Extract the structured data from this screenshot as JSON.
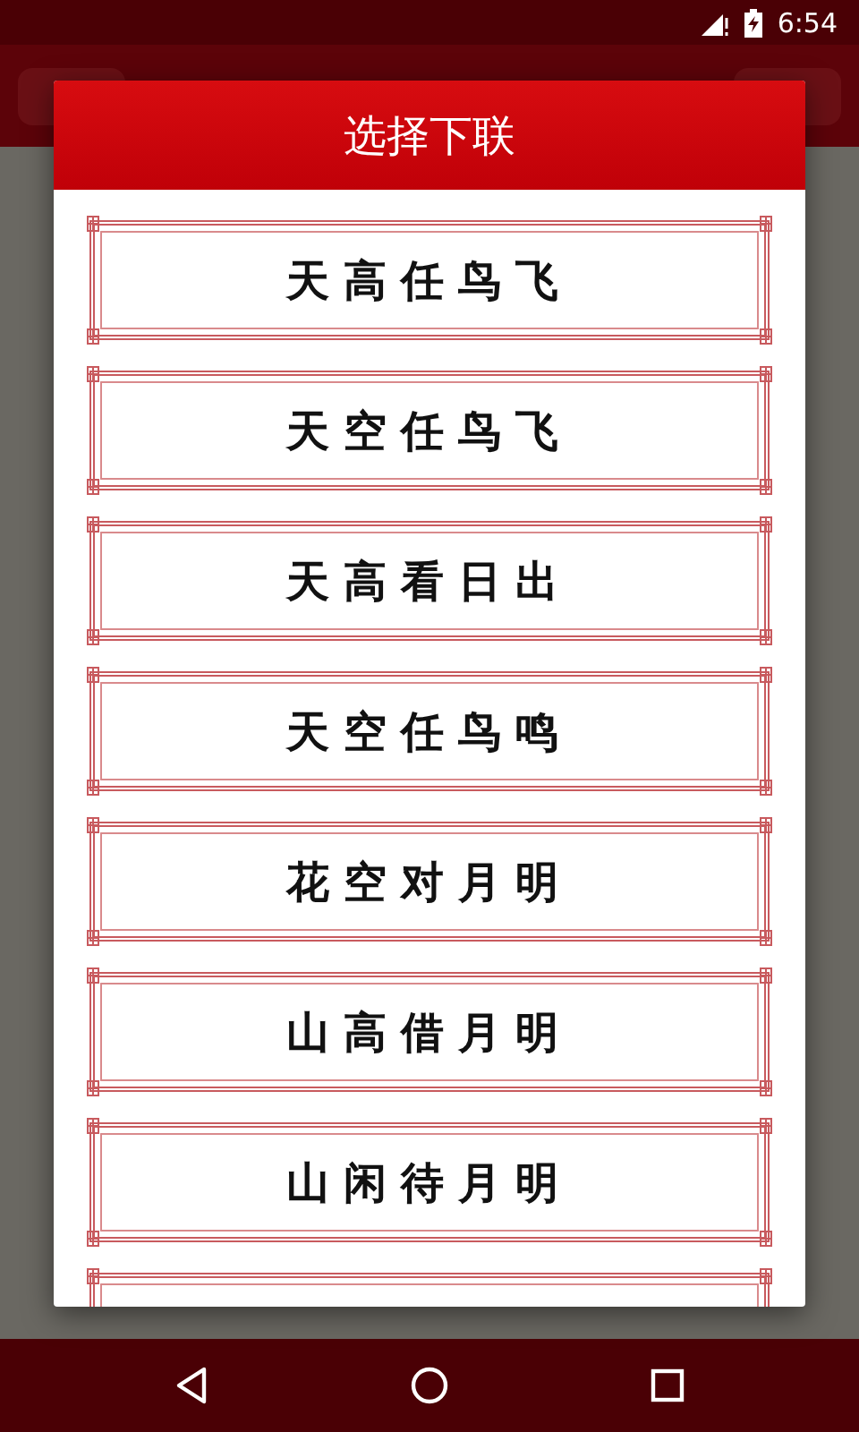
{
  "status_bar": {
    "time": "6:54"
  },
  "dialog": {
    "title": "选择下联",
    "options": [
      {
        "text": "天高任鸟飞"
      },
      {
        "text": "天空任鸟飞"
      },
      {
        "text": "天高看日出"
      },
      {
        "text": "天空任鸟鸣"
      },
      {
        "text": "花空对月明"
      },
      {
        "text": "山高借月明"
      },
      {
        "text": "山闲待月明"
      }
    ]
  }
}
